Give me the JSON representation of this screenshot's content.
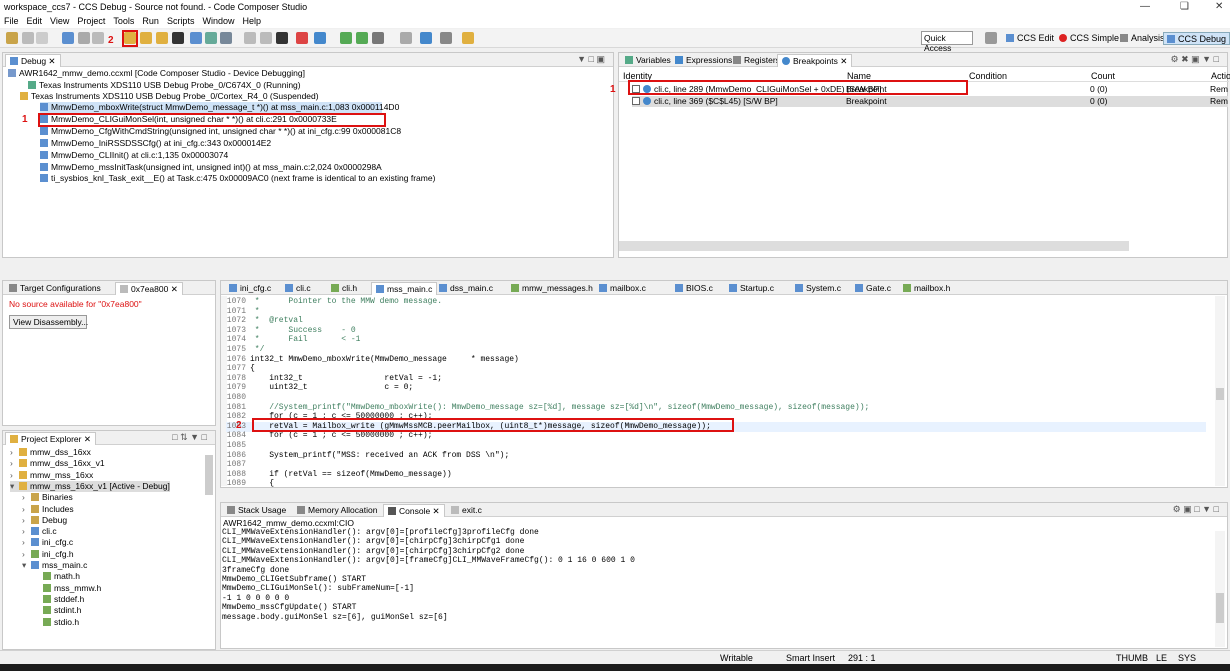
{
  "window": {
    "title": "workspace_ccs7 - CCS Debug - Source not found. - Code Composer Studio"
  },
  "menu": [
    "File",
    "Edit",
    "View",
    "Project",
    "Tools",
    "Run",
    "Scripts",
    "Window",
    "Help"
  ],
  "toolbar": {
    "quick_access": "Quick Access",
    "perspectives": [
      "CCS Edit",
      "CCS Simple",
      "Analysis",
      "CCS Debug"
    ]
  },
  "debug": {
    "tab": "Debug",
    "rows": [
      "AWR1642_mmw_demo.ccxml [Code Composer Studio - Device Debugging]",
      "Texas Instruments XDS110 USB Debug Probe_0/C674X_0 (Running)",
      "Texas Instruments XDS110 USB Debug Probe_0/Cortex_R4_0 (Suspended)",
      "MmwDemo_mboxWrite(struct MmwDemo_message_t *)() at mss_main.c:1,083 0x000114D0",
      "MmwDemo_CLIGuiMonSel(int, unsigned char * *)() at cli.c:291 0x0000733E",
      "MmwDemo_CfgWithCmdString(unsigned int, unsigned char * *)() at ini_cfg.c:99 0x000081C8",
      "MmwDemo_IniRSSDSSCfg() at ini_cfg.c:343 0x000014E2",
      "MmwDemo_CLIInit() at cli.c:1,135 0x00003074",
      "MmwDemo_mssInitTask(unsigned int, unsigned int)() at mss_main.c:2,024 0x0000298A",
      "ti_sysbios_knl_Task_exit__E() at Task.c:475 0x00009AC0  (next frame is identical to an existing frame)"
    ]
  },
  "annotations": {
    "one": "1",
    "two": "2"
  },
  "bp_view": {
    "tabs": [
      "Variables",
      "Expressions",
      "Registers",
      "Breakpoints"
    ],
    "columns": [
      "Identity",
      "Name",
      "Condition",
      "Count",
      "Actio"
    ],
    "rows": [
      {
        "identity": "cli.c, line 289 (MmwDemo_CLIGuiMonSel + 0xDE)  [S/W BP]",
        "name": "Breakpoint",
        "count": "0 (0)",
        "action": "Rem"
      },
      {
        "identity": "cli.c, line 369 ($C$L45)  [S/W BP]",
        "name": "Breakpoint",
        "count": "0 (0)",
        "action": "Rem"
      }
    ]
  },
  "target": {
    "tabs": [
      "Target Configurations",
      "0x7ea800"
    ],
    "message": "No source available for \"0x7ea800\"",
    "button": "View Disassembly..."
  },
  "editor": {
    "tabs": [
      "ini_cfg.c",
      "cli.c",
      "cli.h",
      "mss_main.c",
      "dss_main.c",
      "mmw_messages.h",
      "mailbox.c",
      "BIOS.c",
      "Startup.c",
      "System.c",
      "Gate.c",
      "mailbox.h"
    ],
    "lines": [
      {
        "n": "1070",
        "t": " *      Pointer to the MMW demo message."
      },
      {
        "n": "1071",
        "t": " *"
      },
      {
        "n": "1072",
        "t": " *  @retval"
      },
      {
        "n": "1073",
        "t": " *      Success    - 0"
      },
      {
        "n": "1074",
        "t": " *      Fail       < -1"
      },
      {
        "n": "1075",
        "t": " */"
      },
      {
        "n": "1076",
        "t": "int32_t MmwDemo_mboxWrite(MmwDemo_message     * message)"
      },
      {
        "n": "1077",
        "t": "{"
      },
      {
        "n": "1078",
        "t": "    int32_t                 retVal = -1;"
      },
      {
        "n": "1079",
        "t": "    uint32_t                c = 0;"
      },
      {
        "n": "1080",
        "t": ""
      },
      {
        "n": "1081",
        "t": "    //System_printf(\"MmwDemo_mboxWrite(): MmwDemo_message sz=[%d], message sz=[%d]\\n\", sizeof(MmwDemo_message), sizeof(message));"
      },
      {
        "n": "1082",
        "t": "    for (c = 1 ; c <= 50000000 ; c++);"
      },
      {
        "n": "1083",
        "t": "    retVal = Mailbox_write (gMmwMssMCB.peerMailbox, (uint8_t*)message, sizeof(MmwDemo_message));"
      },
      {
        "n": "1084",
        "t": "    for (c = 1 ; c <= 50000000 ; c++);"
      },
      {
        "n": "1085",
        "t": ""
      },
      {
        "n": "1086",
        "t": "    System_printf(\"MSS: received an ACK from DSS \\n\");"
      },
      {
        "n": "1087",
        "t": ""
      },
      {
        "n": "1088",
        "t": "    if (retVal == sizeof(MmwDemo_message))"
      },
      {
        "n": "1089",
        "t": "    {"
      }
    ]
  },
  "project": {
    "tab": "Project Explorer",
    "items": [
      {
        "label": "mmw_dss_16xx",
        "level": 0
      },
      {
        "label": "mmw_dss_16xx_v1",
        "level": 0
      },
      {
        "label": "mmw_mss_16xx",
        "level": 0
      },
      {
        "label": "mmw_mss_16xx_v1  [Active - Debug]",
        "level": 0
      },
      {
        "label": "Binaries",
        "level": 1
      },
      {
        "label": "Includes",
        "level": 1
      },
      {
        "label": "Debug",
        "level": 1
      },
      {
        "label": "cli.c",
        "level": 1
      },
      {
        "label": "ini_cfg.c",
        "level": 1
      },
      {
        "label": "ini_cfg.h",
        "level": 1
      },
      {
        "label": "mss_main.c",
        "level": 1
      },
      {
        "label": "math.h",
        "level": 2
      },
      {
        "label": "mss_mmw.h",
        "level": 2
      },
      {
        "label": "stddef.h",
        "level": 2
      },
      {
        "label": "stdint.h",
        "level": 2
      },
      {
        "label": "stdio.h",
        "level": 2
      }
    ]
  },
  "bottom": {
    "tabs": [
      "Stack Usage",
      "Memory Allocation",
      "Console",
      "exit.c"
    ],
    "console_title": "AWR1642_mmw_demo.ccxml:CIO",
    "lines": [
      "CLI_MMWaveExtensionHandler(): argv[0]=[profileCfg]3profileCfg done",
      "CLI_MMWaveExtensionHandler(): argv[0]=[chirpCfg]3chirpCfg1 done",
      "CLI_MMWaveExtensionHandler(): argv[0]=[chirpCfg]3chirpCfg2 done",
      "CLI_MMWaveExtensionHandler(): argv[0]=[frameCfg]CLI_MMWaveFrameCfg(): 0 1 16 0 600 1 0",
      "3frameCfg done",
      "MmwDemo_CLIGetSubframe() START",
      "MmwDemo_CLIGuiMonSel(): subFrameNum=[-1]",
      "-1 1 0 0 0 0 0",
      "MmwDemo_mssCfgUpdate() START",
      "message.body.guiMonSel sz=[6], guiMonSel sz=[6]"
    ]
  },
  "status": {
    "writable": "Writable",
    "insert": "Smart Insert",
    "pos": "291 : 1",
    "thumb": "THUMB",
    "le": "LE",
    "sys": "SYS"
  }
}
